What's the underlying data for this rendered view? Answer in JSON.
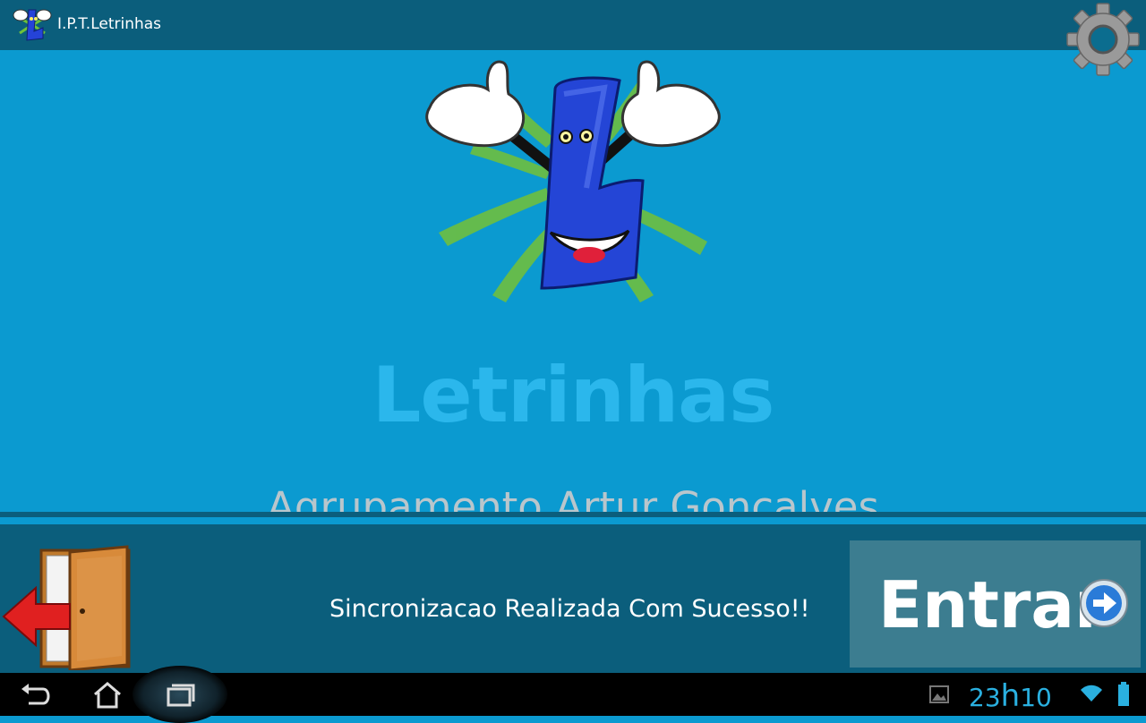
{
  "app": {
    "title": "I.P.T.Letrinhas"
  },
  "main": {
    "logo_text": "Letrinhas",
    "school_name": "Agrupamento Artur Gonçalves"
  },
  "bottom": {
    "status_message": "Sincronizacao Realizada Com Sucesso!!",
    "enter_label": "Entrar"
  },
  "system": {
    "clock_hours": "23",
    "clock_sep": "h",
    "clock_minutes": "10"
  },
  "icons": {
    "app": "letrinhas-mascot-icon",
    "settings": "gear-icon",
    "exit": "exit-door-icon",
    "enter": "arrow-right-circle-icon",
    "back": "back-icon",
    "home": "home-icon",
    "recents": "recent-apps-icon",
    "gallery": "gallery-icon",
    "wifi": "wifi-icon",
    "battery": "battery-icon"
  },
  "colors": {
    "main_background": "#0b9ad0",
    "bars": "#0b5e7c",
    "logo_text": "#2bb7ec",
    "enter_button": "#3c7d90",
    "clock": "#2ab0e0"
  }
}
